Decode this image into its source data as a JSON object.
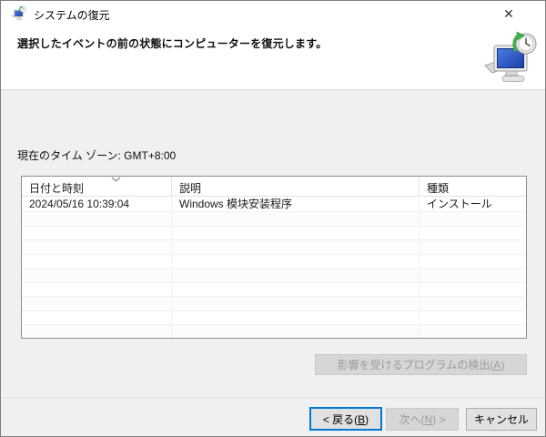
{
  "window": {
    "title": "システムの復元",
    "close_glyph": "✕"
  },
  "header": {
    "instruction": "選択したイベントの前の状態にコンピューターを復元します。"
  },
  "content": {
    "timezone_label": "現在のタイム ゾーン: GMT+8:00"
  },
  "table": {
    "columns": [
      {
        "label": "日付と時刻",
        "sort": "descending"
      },
      {
        "label": "説明",
        "sort": "none"
      },
      {
        "label": "種類",
        "sort": "none"
      }
    ],
    "rows": [
      {
        "datetime": "2024/05/16 10:39:04",
        "description": "Windows 模块安装程序",
        "type": "インストール"
      }
    ],
    "empty_row_count": 9
  },
  "buttons": {
    "detect": {
      "pre": "影響を受けるプログラムの検出(",
      "key": "A",
      "post": ")",
      "state": "disabled"
    },
    "back": {
      "pre": "< 戻る(",
      "key": "B",
      "post": ")",
      "state": "focused"
    },
    "next": {
      "pre": "次へ(",
      "key": "N",
      "post": ") >",
      "state": "disabled"
    },
    "cancel": {
      "label": "キャンセル",
      "state": "enabled"
    }
  },
  "icons": {
    "app_icon": "system-restore-icon",
    "illustration": "computer-with-restore-clock-icon",
    "sort_indicator": "chevron-down-icon",
    "close": "close-icon"
  },
  "colors": {
    "accent_focus": "#0078d7",
    "header_bg": "#ffffff",
    "body_bg": "#f0f0f0",
    "table_border": "#8c8c8c",
    "screen_blue": "#2b4fc0",
    "restore_green": "#3faf4b",
    "disabled_text": "#9b9b9b"
  }
}
